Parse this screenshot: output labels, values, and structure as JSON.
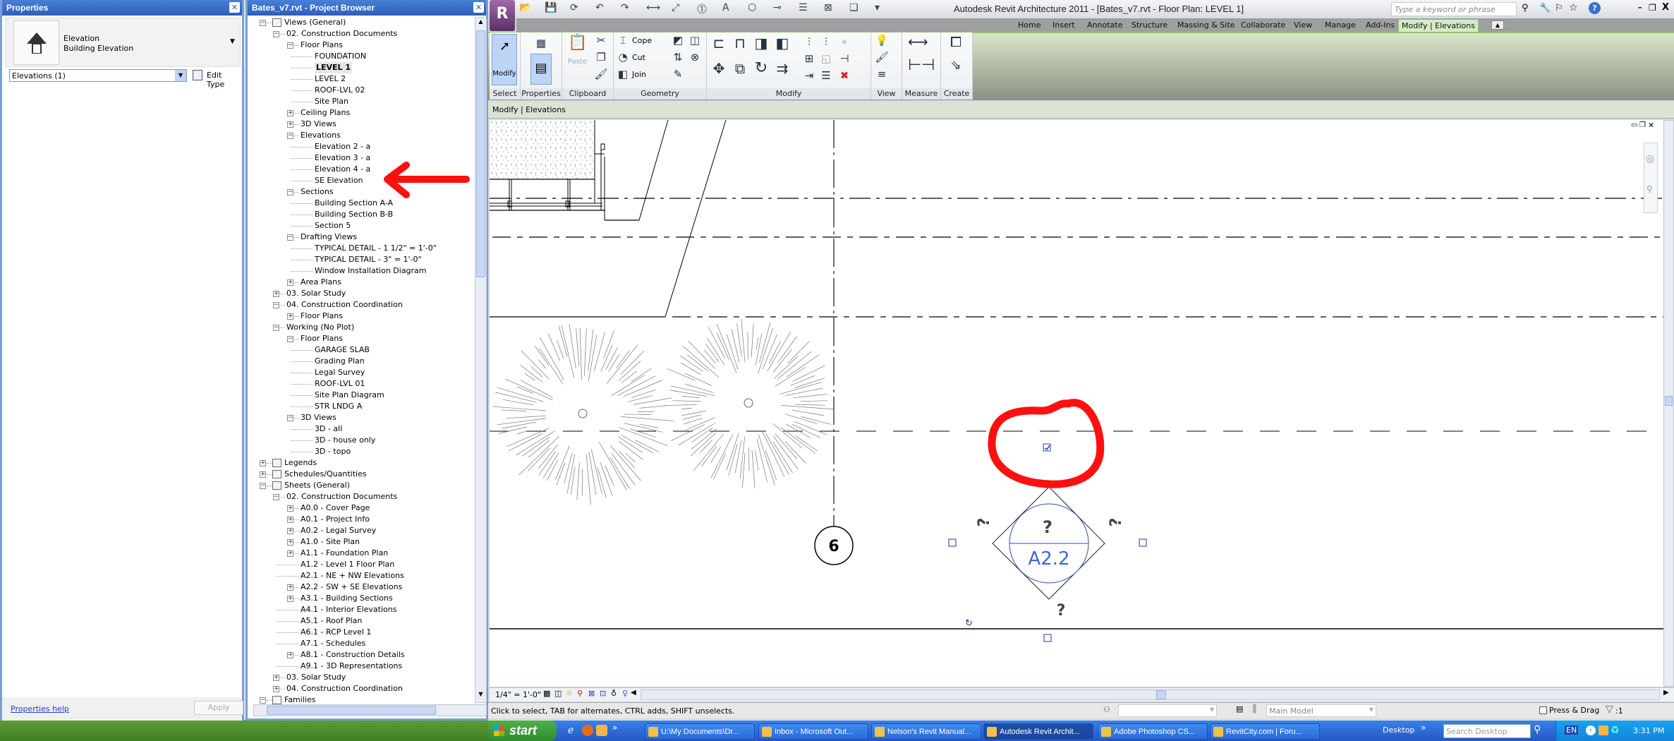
{
  "properties": {
    "title": "Properties",
    "type_line1": "Elevation",
    "type_line2": "Building Elevation",
    "instance_filter": "Elevations (1)",
    "edit_type": "Edit Type",
    "help_link": "Properties help",
    "apply": "Apply"
  },
  "browser": {
    "title": "Bates_v7.rvt - Project Browser",
    "rows": [
      {
        "label": "Views (General)",
        "level": 0,
        "exp": "-",
        "icon": "views"
      },
      {
        "label": "02. Construction Documents",
        "level": 1,
        "exp": "-"
      },
      {
        "label": "Floor Plans",
        "level": 2,
        "exp": "-"
      },
      {
        "label": "FOUNDATION",
        "level": 3
      },
      {
        "label": "LEVEL 1",
        "level": 3,
        "bold": true
      },
      {
        "label": "LEVEL 2",
        "level": 3
      },
      {
        "label": "ROOF-LVL 02",
        "level": 3
      },
      {
        "label": "Site Plan",
        "level": 3
      },
      {
        "label": "Ceiling Plans",
        "level": 2,
        "exp": "+"
      },
      {
        "label": "3D Views",
        "level": 2,
        "exp": "+"
      },
      {
        "label": "Elevations",
        "level": 2,
        "exp": "-"
      },
      {
        "label": "Elevation 2 - a",
        "level": 3
      },
      {
        "label": "Elevation 3 - a",
        "level": 3
      },
      {
        "label": "Elevation 4 - a",
        "level": 3
      },
      {
        "label": "SE Elevation",
        "level": 3
      },
      {
        "label": "Sections",
        "level": 2,
        "exp": "-"
      },
      {
        "label": "Building Section A-A",
        "level": 3
      },
      {
        "label": "Building Section B-B",
        "level": 3
      },
      {
        "label": "Section 5",
        "level": 3
      },
      {
        "label": "Drafting Views",
        "level": 2,
        "exp": "-"
      },
      {
        "label": "TYPICAL DETAIL - 1 1/2\" = 1'-0\"",
        "level": 3
      },
      {
        "label": "TYPICAL DETAIL - 3\" = 1'-0\"",
        "level": 3
      },
      {
        "label": "Window Installation Diagram",
        "level": 3
      },
      {
        "label": "Area Plans",
        "level": 2,
        "exp": "+"
      },
      {
        "label": "03. Solar Study",
        "level": 1,
        "exp": "+"
      },
      {
        "label": "04. Construction Coordination",
        "level": 1,
        "exp": "-"
      },
      {
        "label": "Floor Plans",
        "level": 2,
        "exp": "+"
      },
      {
        "label": "Working (No Plot)",
        "level": 1,
        "exp": "-"
      },
      {
        "label": "Floor Plans",
        "level": 2,
        "exp": "-"
      },
      {
        "label": "GARAGE SLAB",
        "level": 3
      },
      {
        "label": "Grading Plan",
        "level": 3
      },
      {
        "label": "Legal Survey",
        "level": 3
      },
      {
        "label": "ROOF-LVL 01",
        "level": 3
      },
      {
        "label": "Site Plan Diagram",
        "level": 3
      },
      {
        "label": "STR LNDG A",
        "level": 3
      },
      {
        "label": "3D Views",
        "level": 2,
        "exp": "-"
      },
      {
        "label": "3D - all",
        "level": 3
      },
      {
        "label": "3D - house only",
        "level": 3
      },
      {
        "label": "3D - topo",
        "level": 3
      },
      {
        "label": "Legends",
        "level": 0,
        "exp": "+",
        "icon": "legend"
      },
      {
        "label": "Schedules/Quantities",
        "level": 0,
        "exp": "+",
        "icon": "schedule"
      },
      {
        "label": "Sheets (General)",
        "level": 0,
        "exp": "-",
        "icon": "sheet"
      },
      {
        "label": "02. Construction Documents",
        "level": 1,
        "exp": "-"
      },
      {
        "label": "A0.0 - Cover Page",
        "level": 2,
        "exp": "+"
      },
      {
        "label": "A0.1 - Project Info",
        "level": 2,
        "exp": "+"
      },
      {
        "label": "A0.2 - Legal Survey",
        "level": 2,
        "exp": "+"
      },
      {
        "label": "A1.0 - Site Plan",
        "level": 2,
        "exp": "+"
      },
      {
        "label": "A1.1 - Foundation Plan",
        "level": 2,
        "exp": "+"
      },
      {
        "label": "A1.2 - Level 1 Floor Plan",
        "level": 2
      },
      {
        "label": "A2.1 - NE + NW Elevations",
        "level": 2
      },
      {
        "label": "A2.2 - SW + SE Elevations",
        "level": 2,
        "exp": "+"
      },
      {
        "label": "A3.1 - Building Sections",
        "level": 2,
        "exp": "+"
      },
      {
        "label": "A4.1 - Interior Elevations",
        "level": 2
      },
      {
        "label": "A5.1 - Roof Plan",
        "level": 2
      },
      {
        "label": "A6.1 - RCP Level 1",
        "level": 2
      },
      {
        "label": "A7.1 - Schedules",
        "level": 2
      },
      {
        "label": "A8.1 - Construction Details",
        "level": 2,
        "exp": "+"
      },
      {
        "label": "A9.1 - 3D Representations",
        "level": 2
      },
      {
        "label": "03. Solar Study",
        "level": 1,
        "exp": "+"
      },
      {
        "label": "04. Construction Coordination",
        "level": 1,
        "exp": "+"
      },
      {
        "label": "Families",
        "level": 0,
        "exp": "-",
        "icon": "families"
      }
    ]
  },
  "app": {
    "title": "Autodesk Revit Architecture 2011 - [Bates_v7.rvt - Floor Plan: LEVEL 1]",
    "search_placeholder": "Type a keyword or phrase",
    "tabs": [
      "Home",
      "Insert",
      "Annotate",
      "Structure",
      "Massing & Site",
      "Collaborate",
      "View",
      "Manage",
      "Add-Ins",
      "Modify | Elevations"
    ],
    "active_tab": "Modify | Elevations",
    "panels": {
      "select": "Select",
      "properties": "Properties",
      "clipboard": "Clipboard",
      "geometry": "Geometry",
      "modify": "Modify",
      "view": "View",
      "measure": "Measure",
      "create": "Create"
    },
    "modify_btn": "Modify",
    "paste_btn": "Paste",
    "cope": "Cope",
    "cut": "Cut",
    "join": "Join",
    "options_bar": "Modify | Elevations"
  },
  "canvas": {
    "grid_label": "6",
    "elev_sheet": "A2.2",
    "elev_view_num": "?",
    "elev_q_left": "?",
    "elev_q_right": "?",
    "elev_q_bottom": "?",
    "annotation_color": "#ff0000"
  },
  "view_bar": {
    "scale": "1/4\" = 1'-0\""
  },
  "status": {
    "message": "Click to select, TAB for alternates, CTRL adds, SHIFT unselects.",
    "workset": "",
    "design_option": "Main Model",
    "press_drag": "Press & Drag",
    "filter_count": ":1"
  },
  "taskbar": {
    "start": "start",
    "items": [
      "U:\\My Documents\\Dr...",
      "Inbox - Microsoft Out...",
      "Nelson's Revit Manual...",
      "Autodesk Revit Archit...",
      "Adobe Photoshop CS...",
      "RevitCity.com | Foru..."
    ],
    "active_index": 3,
    "desktop": "Desktop",
    "search_placeholder": "Search Desktop",
    "lang": "EN",
    "clock": "3:31 PM"
  }
}
